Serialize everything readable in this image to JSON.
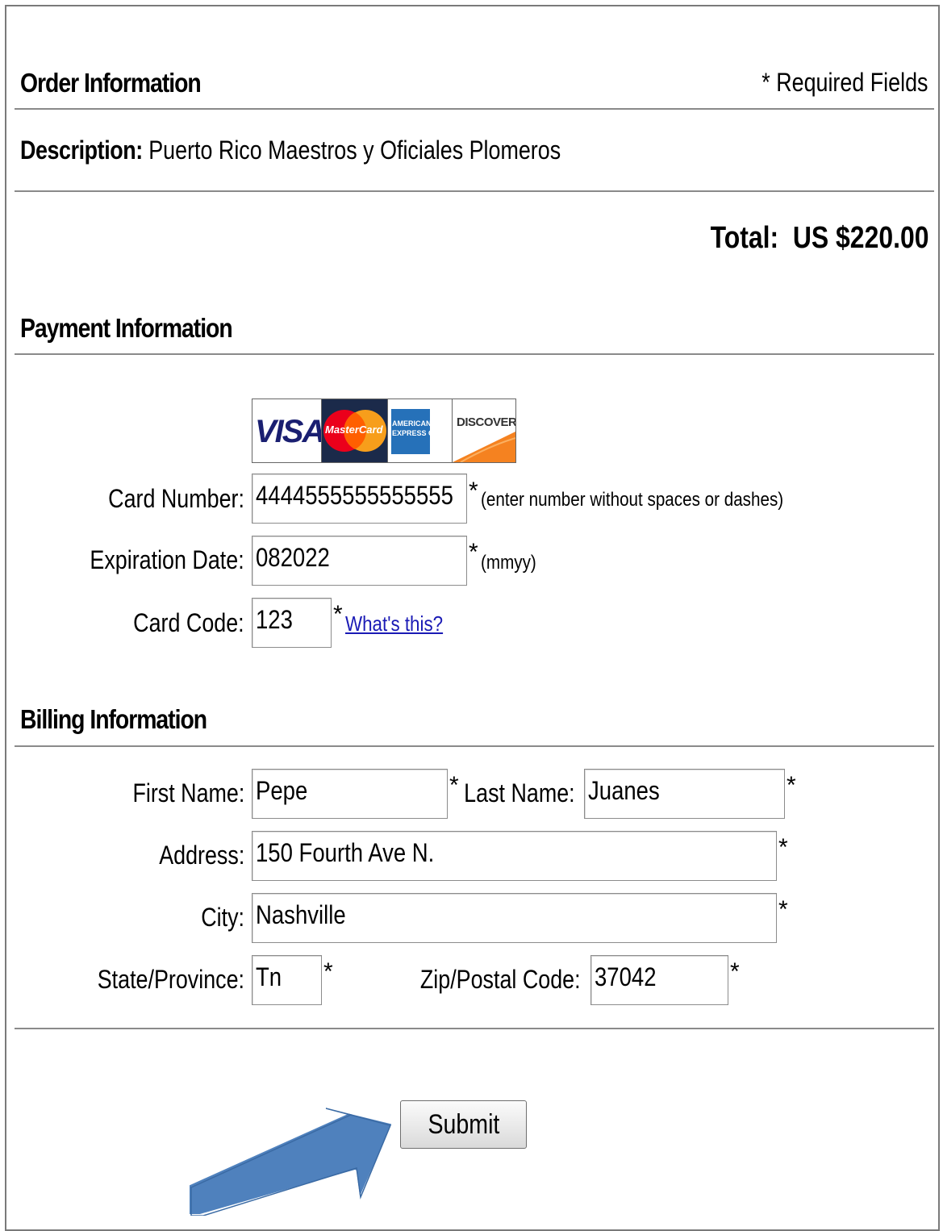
{
  "order": {
    "heading": "Order Information",
    "required_note": "* Required Fields",
    "description_label": "Description:",
    "description_value": "Puerto Rico Maestros y Oficiales Plomeros",
    "total_label": "Total:",
    "total_value": "US $220.00"
  },
  "payment": {
    "heading": "Payment Information",
    "cards": [
      {
        "name": "visa-logo",
        "text": "VISA",
        "color": "#1a1f71"
      },
      {
        "name": "mastercard-logo",
        "text": "MasterCard",
        "colors": [
          "#eb001b",
          "#f79e1b"
        ]
      },
      {
        "name": "amex-logo",
        "text": "AMERICAN EXPRESS Cards",
        "color": "#2671b9"
      },
      {
        "name": "discover-logo",
        "text": "DISCOVER",
        "color": "#f58220"
      }
    ],
    "card_number_label": "Card Number:",
    "card_number_value": "4444555555555555",
    "card_number_hint": "(enter number without spaces or dashes)",
    "expiration_label": "Expiration Date:",
    "expiration_value": "082022",
    "expiration_hint": "(mmyy)",
    "card_code_label": "Card Code:",
    "card_code_value": "123",
    "card_code_link": "What's this?",
    "required_mark": "*"
  },
  "billing": {
    "heading": "Billing Information",
    "first_name_label": "First Name:",
    "first_name_value": "Pepe",
    "last_name_label": "Last Name:",
    "last_name_value": "Juanes",
    "address_label": "Address:",
    "address_value": "150 Fourth Ave N.",
    "city_label": "City:",
    "city_value": "Nashville",
    "state_label": "State/Province:",
    "state_value": "Tn",
    "zip_label": "Zip/Postal Code:",
    "zip_value": "37042"
  },
  "actions": {
    "submit_label": "Submit"
  },
  "colors": {
    "arrow": "#4f81bd",
    "link": "#1a1ab5",
    "rule": "#8a8a8a"
  }
}
